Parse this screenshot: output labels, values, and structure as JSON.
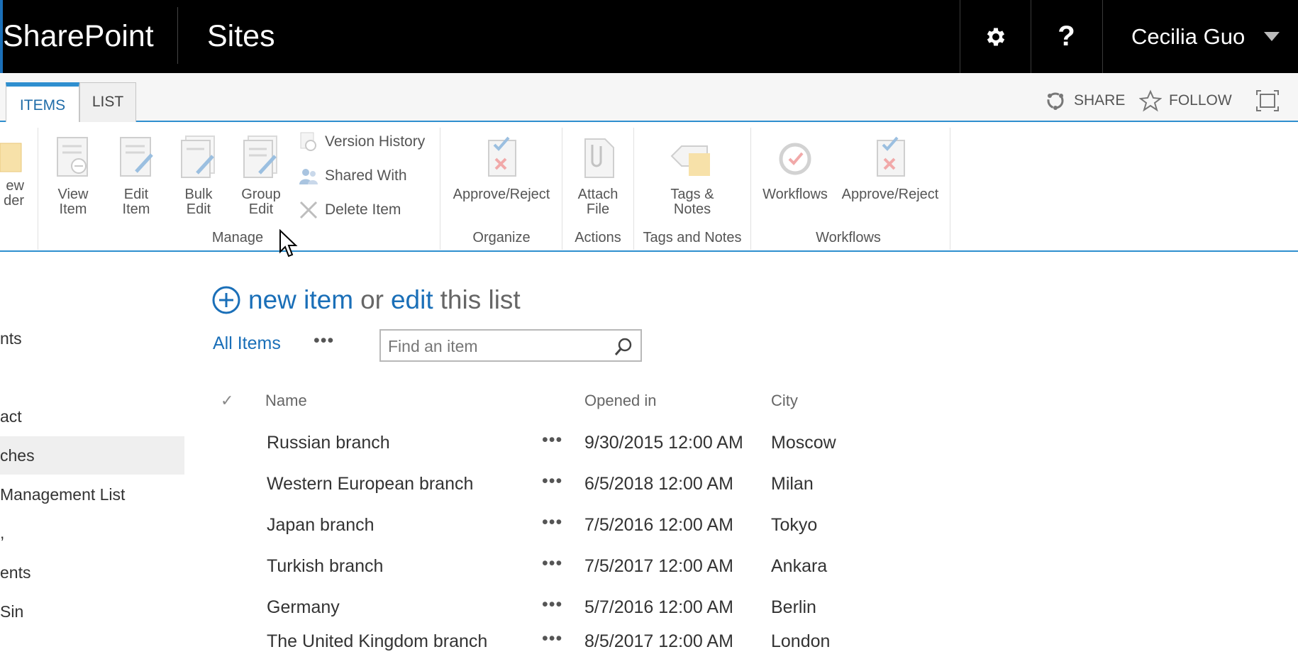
{
  "suite_bar": {
    "brand": "SharePoint",
    "site_link": "Sites",
    "user_name": "Cecilia Guo",
    "gear_icon": "gear-icon",
    "help_label": "?"
  },
  "ribbon": {
    "tabs": [
      "ITEMS",
      "LIST"
    ],
    "active_tab": "ITEMS",
    "share_label": "SHARE",
    "follow_label": "FOLLOW",
    "groups": {
      "manage": {
        "label": "Manage",
        "partial_button": [
          "ew",
          "der"
        ],
        "buttons": [
          {
            "line1": "View",
            "line2": "Item"
          },
          {
            "line1": "Edit",
            "line2": "Item"
          },
          {
            "line1": "Bulk",
            "line2": "Edit"
          },
          {
            "line1": "Group",
            "line2": "Edit"
          }
        ],
        "small_buttons": [
          "Version History",
          "Shared With",
          "Delete Item"
        ]
      },
      "organize": {
        "label": "Organize",
        "button": "Approve/Reject"
      },
      "actions": {
        "label": "Actions",
        "line1": "Attach",
        "line2": "File"
      },
      "tags": {
        "label": "Tags and Notes",
        "line1": "Tags &",
        "line2": "Notes"
      },
      "workflows": {
        "label": "Workflows",
        "buttons": [
          "Workflows",
          "Approve/Reject"
        ]
      }
    }
  },
  "left_nav": {
    "items": [
      "nts",
      "act",
      "ches",
      "Management List",
      ",",
      "ents",
      "Sin"
    ],
    "selected_index": 2
  },
  "main": {
    "new_item": {
      "new_item_label": "new item",
      "or_label": "or",
      "edit_label": "edit",
      "this_list_label": "this list"
    },
    "view_name": "All Items",
    "view_more": "•••",
    "search_placeholder": "Find an item",
    "columns": {
      "check": "✓",
      "name": "Name",
      "opened": "Opened in",
      "city": "City"
    },
    "rows": [
      {
        "name": "Russian branch",
        "opened": "9/30/2015 12:00 AM",
        "city": "Moscow"
      },
      {
        "name": "Western European branch",
        "opened": "6/5/2018 12:00 AM",
        "city": "Milan"
      },
      {
        "name": "Japan branch",
        "opened": "7/5/2016 12:00 AM",
        "city": "Tokyo"
      },
      {
        "name": "Turkish branch",
        "opened": "7/5/2017 12:00 AM",
        "city": "Ankara"
      },
      {
        "name": "Germany",
        "opened": "5/7/2016 12:00 AM",
        "city": "Berlin"
      },
      {
        "name": "The United Kingdom branch",
        "opened": "8/5/2017 12:00 AM",
        "city": "London"
      }
    ],
    "row_more": "•••"
  }
}
